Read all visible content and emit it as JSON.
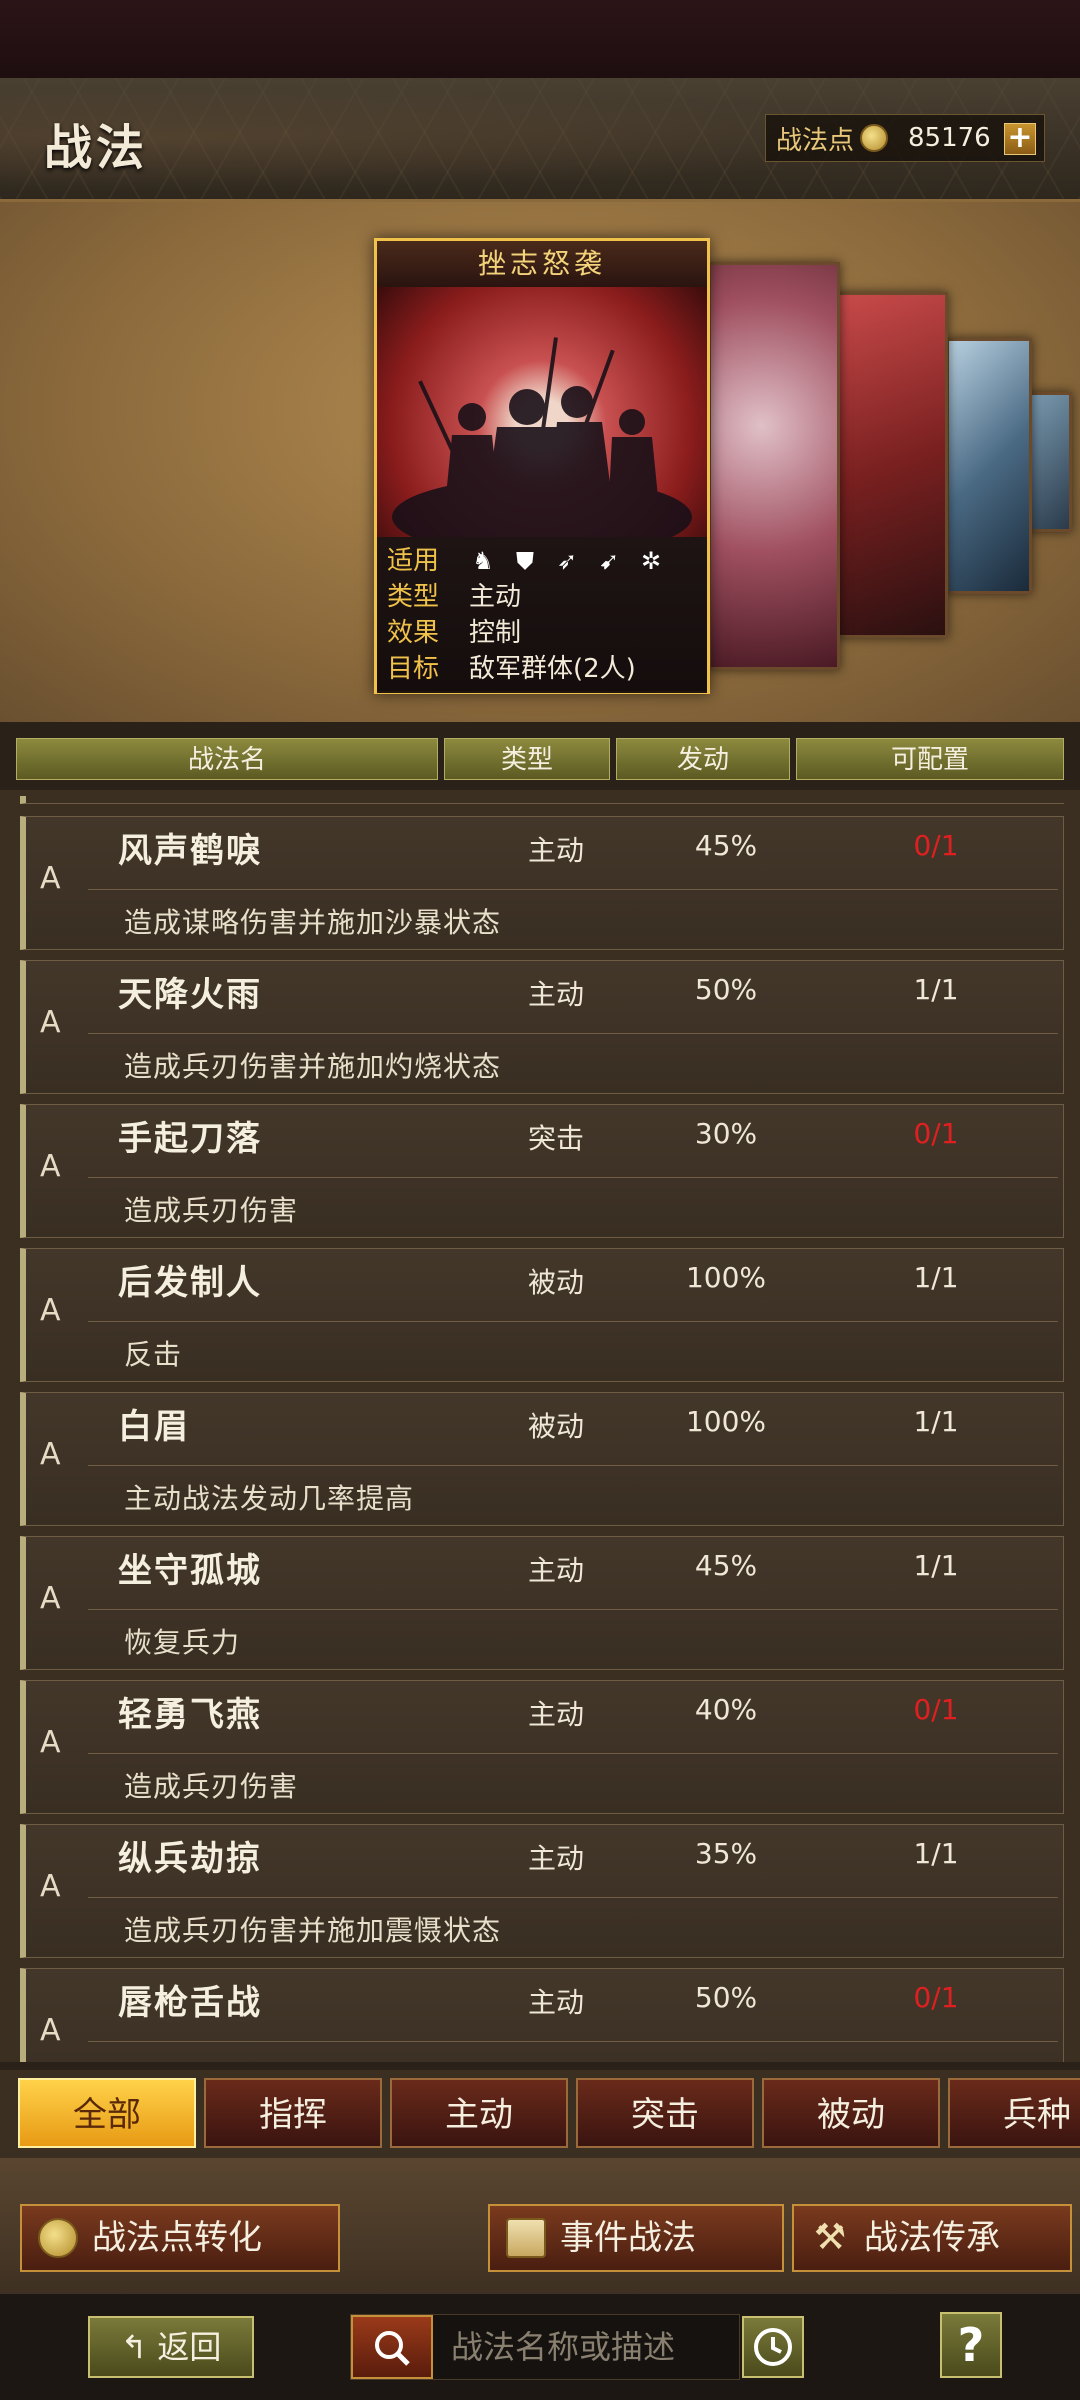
{
  "header": {
    "title": "战法",
    "points_label": "战法点",
    "points_value": "85176",
    "plus_label": "+"
  },
  "featured_card": {
    "title": "挫志怒袭",
    "rows": [
      {
        "key": "适用",
        "value": ""
      },
      {
        "key": "类型",
        "value": "主动"
      },
      {
        "key": "效果",
        "value": "控制"
      },
      {
        "key": "目标",
        "value": "敌军群体(2人)"
      }
    ],
    "troop_icons": [
      "cavalry-icon",
      "shield-icon",
      "bow-icon",
      "spear-icon",
      "wheel-icon"
    ]
  },
  "columns": [
    "战法名",
    "类型",
    "发动",
    "可配置"
  ],
  "tactics": [
    {
      "grade": "A",
      "name": "风声鹤唳",
      "type": "主动",
      "rate": "45%",
      "available": "0/1",
      "full": true,
      "desc": "造成谋略伤害并施加沙暴状态"
    },
    {
      "grade": "A",
      "name": "天降火雨",
      "type": "主动",
      "rate": "50%",
      "available": "1/1",
      "full": false,
      "desc": "造成兵刃伤害并施加灼烧状态"
    },
    {
      "grade": "A",
      "name": "手起刀落",
      "type": "突击",
      "rate": "30%",
      "available": "0/1",
      "full": true,
      "desc": "造成兵刃伤害"
    },
    {
      "grade": "A",
      "name": "后发制人",
      "type": "被动",
      "rate": "100%",
      "available": "1/1",
      "full": false,
      "desc": "反击"
    },
    {
      "grade": "A",
      "name": "白眉",
      "type": "被动",
      "rate": "100%",
      "available": "1/1",
      "full": false,
      "desc": "主动战法发动几率提高"
    },
    {
      "grade": "A",
      "name": "坐守孤城",
      "type": "主动",
      "rate": "45%",
      "available": "1/1",
      "full": false,
      "desc": "恢复兵力"
    },
    {
      "grade": "A",
      "name": "轻勇飞燕",
      "type": "主动",
      "rate": "40%",
      "available": "0/1",
      "full": true,
      "desc": "造成兵刃伤害"
    },
    {
      "grade": "A",
      "name": "纵兵劫掠",
      "type": "主动",
      "rate": "35%",
      "available": "1/1",
      "full": false,
      "desc": "造成兵刃伤害并施加震慑状态"
    },
    {
      "grade": "A",
      "name": "唇枪舌战",
      "type": "主动",
      "rate": "50%",
      "available": "0/1",
      "full": true,
      "desc": ""
    }
  ],
  "tabs": [
    "全部",
    "指挥",
    "主动",
    "突击",
    "被动",
    "兵种"
  ],
  "active_tab": 0,
  "actions": {
    "convert": "战法点转化",
    "event": "事件战法",
    "inherit": "战法传承"
  },
  "bottom": {
    "back": "返回",
    "search_placeholder": "战法名称或描述",
    "help": "?"
  },
  "colors": {
    "accent_gold": "#f0c24a",
    "unavailable_red": "#e02020",
    "active_tab": "#ffd24a"
  }
}
